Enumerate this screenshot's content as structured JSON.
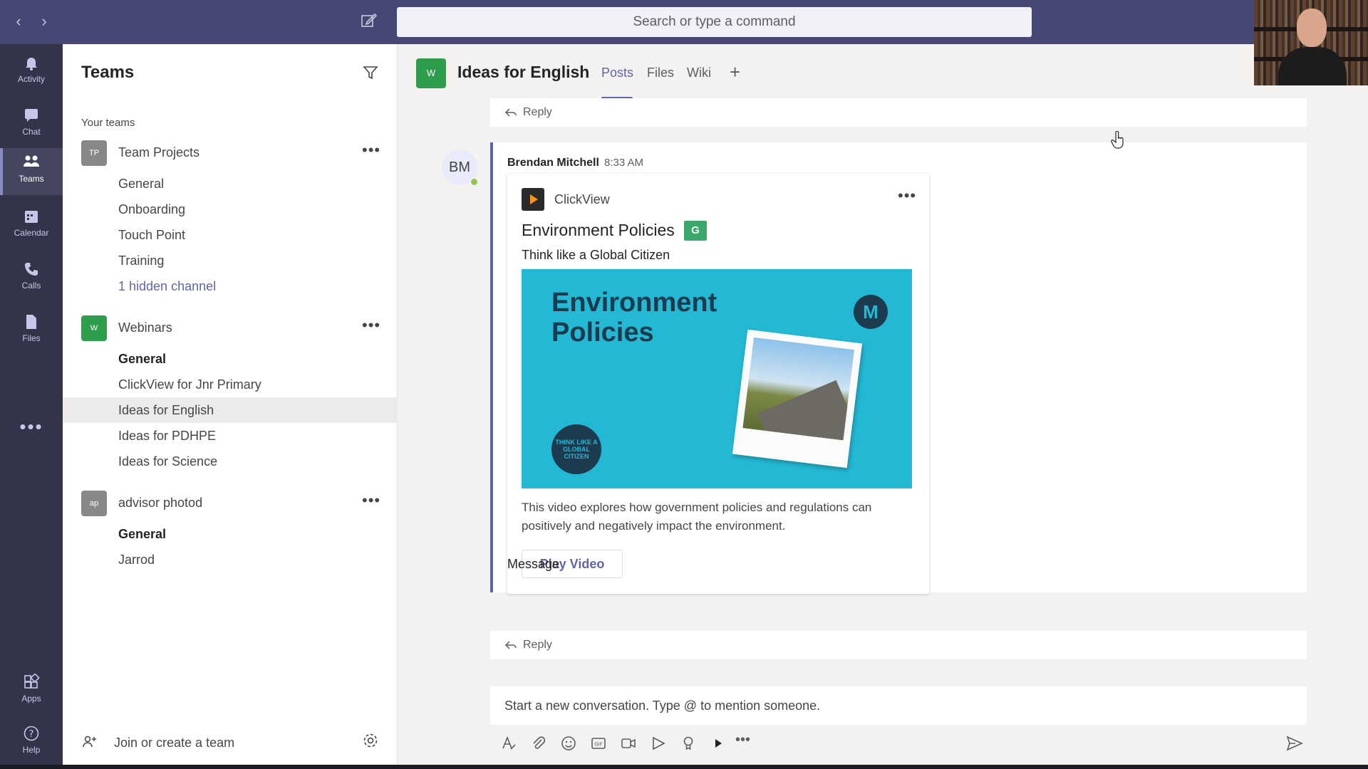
{
  "app": {
    "search_placeholder": "Search or type a command"
  },
  "rail": {
    "items": [
      {
        "label": "Activity",
        "icon": "bell-icon"
      },
      {
        "label": "Chat",
        "icon": "chat-icon"
      },
      {
        "label": "Teams",
        "icon": "teams-icon",
        "active": true
      },
      {
        "label": "Calendar",
        "icon": "calendar-icon"
      },
      {
        "label": "Calls",
        "icon": "phone-icon"
      },
      {
        "label": "Files",
        "icon": "file-icon"
      }
    ],
    "bottom": [
      {
        "label": "Apps",
        "icon": "apps-icon"
      },
      {
        "label": "Help",
        "icon": "help-icon"
      }
    ]
  },
  "teams_panel": {
    "title": "Teams",
    "section_label": "Your teams",
    "teams": [
      {
        "name": "Team Projects",
        "avatar_text": "TP",
        "avatar_color": "#8a8886",
        "channels": [
          "General",
          "Onboarding",
          "Touch Point",
          "Training",
          "1 hidden channel"
        ]
      },
      {
        "name": "Webinars",
        "avatar_text": "W",
        "avatar_color": "#2e9e4c",
        "channels": [
          "General",
          "ClickView for Jnr Primary",
          "Ideas for English",
          "Ideas for PDHPE",
          "Ideas for Science"
        ]
      },
      {
        "name": "advisor photod",
        "avatar_text": "ap",
        "avatar_color": "#8a8886",
        "channels": [
          "General",
          "Jarrod"
        ]
      }
    ],
    "join_label": "Join or create a team"
  },
  "channel": {
    "avatar_text": "W",
    "title": "Ideas for English",
    "tabs": [
      "Posts",
      "Files",
      "Wiki"
    ],
    "active_tab": "Posts"
  },
  "post": {
    "reply_label": "Reply",
    "author": "Brendan Mitchell",
    "author_initials": "BM",
    "time": "8:33 AM",
    "card": {
      "app_name": "ClickView",
      "title": "Environment Policies",
      "badge": "G",
      "subtitle": "Think like a Global Citizen",
      "thumbnail_title": "Environment Policies",
      "thumbnail_logo": "M",
      "thumbnail_stamp": "THINK LIKE A GLOBAL CITIZEN",
      "description": "This video explores how government policies and regulations can positively and negatively impact the environment.",
      "button_label": "Play Video"
    },
    "message": "Message"
  },
  "composer": {
    "placeholder": "Start a new conversation. Type @ to mention someone."
  },
  "colors": {
    "brand": "#6264a7",
    "titlebar": "#464775",
    "rail": "#33344a"
  }
}
